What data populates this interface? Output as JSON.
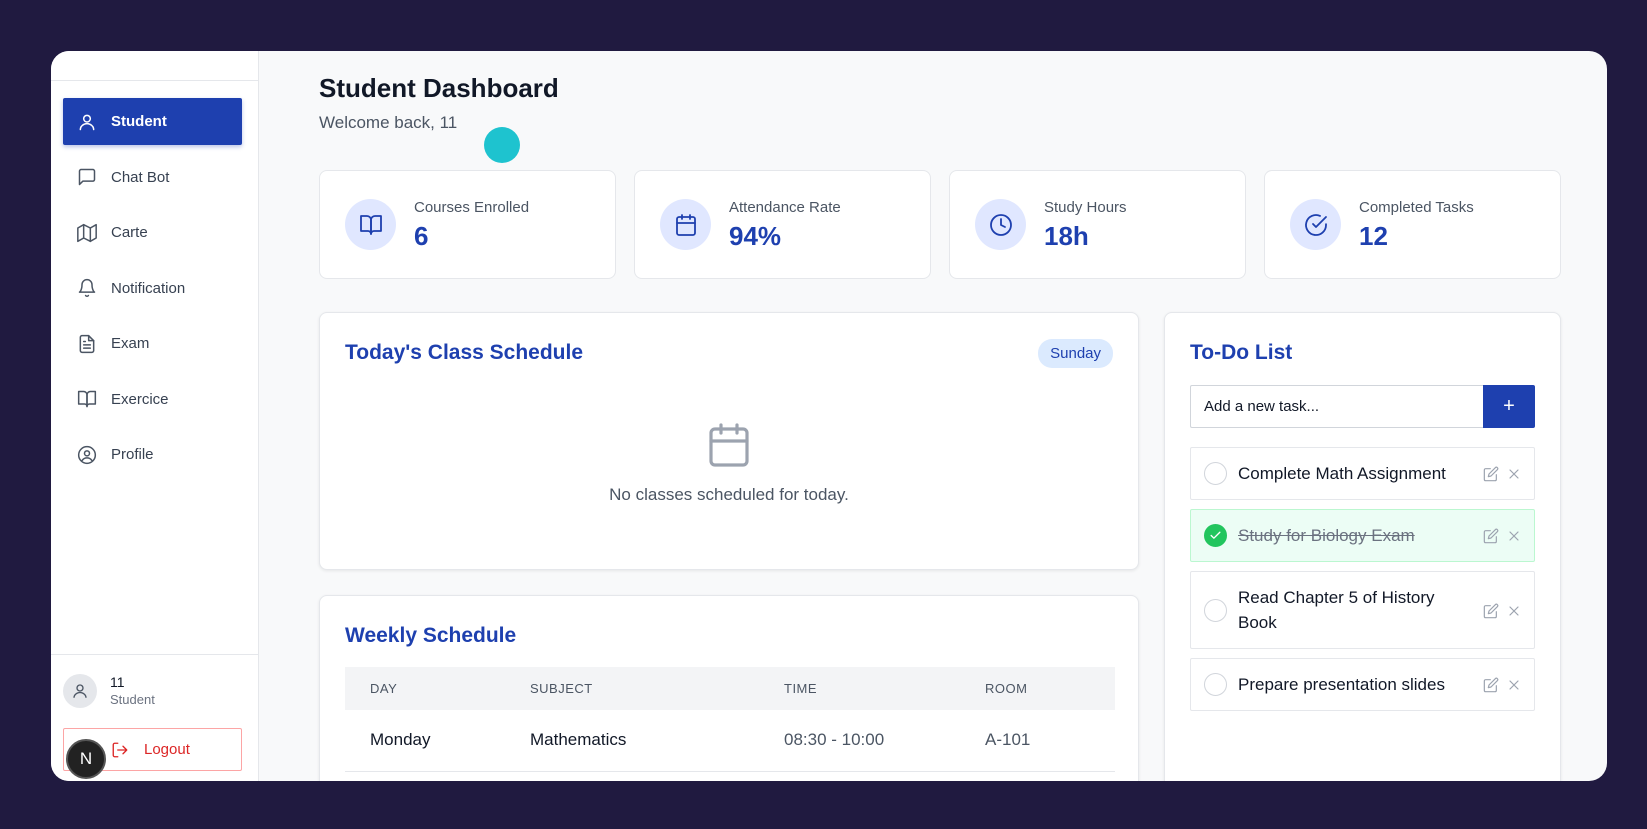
{
  "sidebar": {
    "items": [
      {
        "label": "Student",
        "icon": "user-icon"
      },
      {
        "label": "Chat Bot",
        "icon": "chat-icon"
      },
      {
        "label": "Carte",
        "icon": "map-icon"
      },
      {
        "label": "Notification",
        "icon": "bell-icon"
      },
      {
        "label": "Exam",
        "icon": "file-text-icon"
      },
      {
        "label": "Exercice",
        "icon": "book-open-icon"
      },
      {
        "label": "Profile",
        "icon": "user-circle-icon"
      }
    ],
    "active_item": "Student",
    "user": {
      "name": "11",
      "role": "Student"
    },
    "logout_label": "Logout",
    "badge_letter": "N"
  },
  "header": {
    "title": "Student Dashboard",
    "subtitle": "Welcome back, 11"
  },
  "stats": [
    {
      "label": "Courses Enrolled",
      "value": "6",
      "icon": "book-open-icon"
    },
    {
      "label": "Attendance Rate",
      "value": "94%",
      "icon": "calendar-icon"
    },
    {
      "label": "Study Hours",
      "value": "18h",
      "icon": "clock-icon"
    },
    {
      "label": "Completed Tasks",
      "value": "12",
      "icon": "check-circle-icon"
    }
  ],
  "today_schedule": {
    "title": "Today's Class Schedule",
    "day": "Sunday",
    "empty_message": "No classes scheduled for today."
  },
  "weekly_schedule": {
    "title": "Weekly Schedule",
    "columns": [
      "DAY",
      "SUBJECT",
      "TIME",
      "ROOM"
    ],
    "rows": [
      {
        "day": "Monday",
        "subject": "Mathematics",
        "time": "08:30 - 10:00",
        "room": "A-101"
      }
    ]
  },
  "todo": {
    "title": "To-Do List",
    "input_placeholder": "Add a new task...",
    "add_label": "+",
    "items": [
      {
        "text": "Complete Math Assignment",
        "done": false
      },
      {
        "text": "Study for Biology Exam",
        "done": true
      },
      {
        "text": "Read Chapter 5 of History Book",
        "done": false
      },
      {
        "text": "Prepare presentation slides",
        "done": false
      }
    ]
  },
  "colors": {
    "background": "#201a40",
    "primary": "#1e40af",
    "success": "#22c55e",
    "danger": "#dc2626",
    "accent_cursor": "#1ec3cf"
  }
}
